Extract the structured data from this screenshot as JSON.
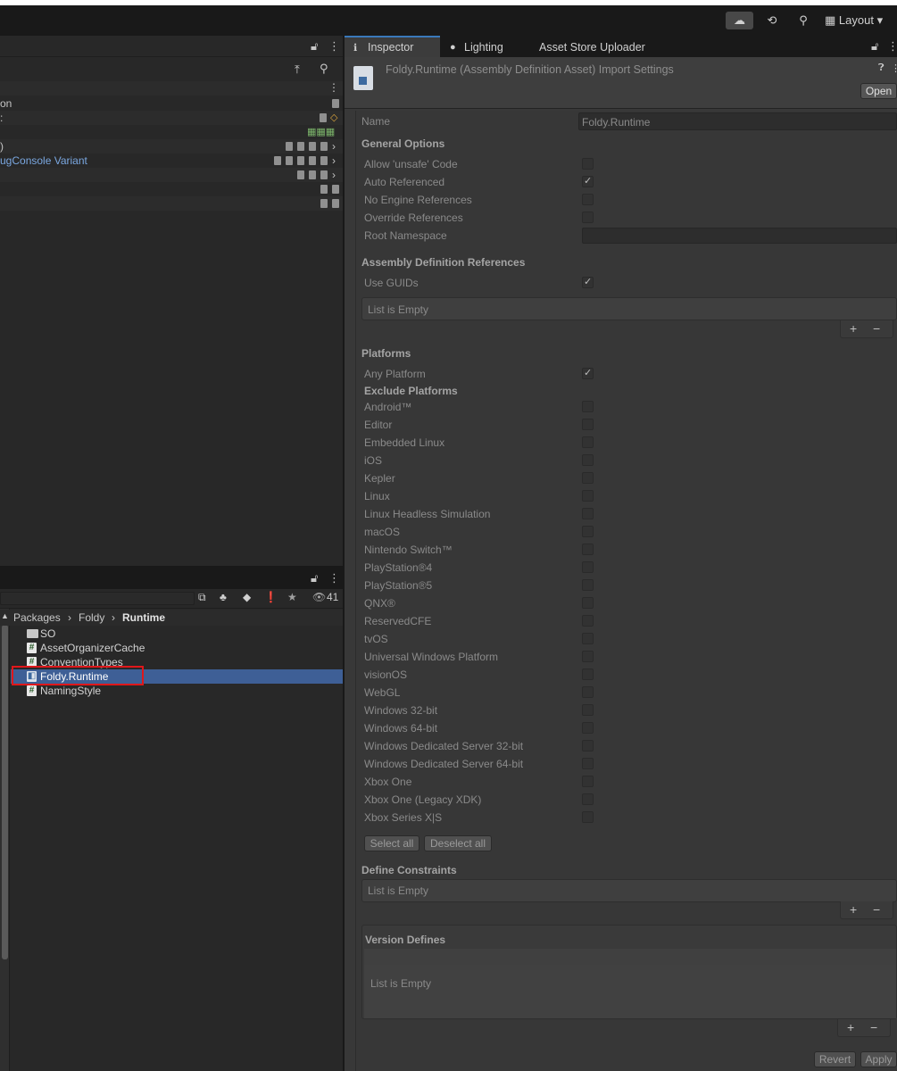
{
  "toolbar": {
    "layout_label": "Layout"
  },
  "hierarchy": {
    "rows": [
      "on",
      "",
      "",
      "",
      "ugConsole Variant",
      "",
      "",
      ""
    ]
  },
  "project": {
    "favorite_count": "41",
    "breadcrumb": [
      "Packages",
      "Foldy",
      "Runtime"
    ],
    "items": [
      {
        "name": "SO",
        "icon": "folder-icon"
      },
      {
        "name": "AssetOrganizerCache",
        "icon": "script-icon"
      },
      {
        "name": "ConventionTypes",
        "icon": "script-icon"
      },
      {
        "name": "Foldy.Runtime",
        "icon": "assembly-definition-icon"
      },
      {
        "name": "NamingStyle",
        "icon": "script-icon"
      }
    ]
  },
  "inspector": {
    "tabs": [
      "Inspector",
      "Lighting",
      "Asset Store Uploader"
    ],
    "title": "Foldy.Runtime (Assembly Definition Asset) Import Settings",
    "open_label": "Open",
    "name_label": "Name",
    "name_value": "Foldy.Runtime",
    "general_header": "General Options",
    "general": [
      {
        "label": "Allow 'unsafe' Code",
        "checked": false
      },
      {
        "label": "Auto Referenced",
        "checked": true
      },
      {
        "label": "No Engine References",
        "checked": false
      },
      {
        "label": "Override References",
        "checked": false
      }
    ],
    "root_namespace_label": "Root Namespace",
    "refs_header": "Assembly Definition References",
    "use_guids_label": "Use GUIDs",
    "list_empty": "List is Empty",
    "platforms_header": "Platforms",
    "any_platform_label": "Any Platform",
    "exclude_header": "Exclude Platforms",
    "platforms": [
      "Android™",
      "Editor",
      "Embedded Linux",
      "iOS",
      "Kepler",
      "Linux",
      "Linux Headless Simulation",
      "macOS",
      "Nintendo Switch™",
      "PlayStation®4",
      "PlayStation®5",
      "QNX®",
      "ReservedCFE",
      "tvOS",
      "Universal Windows Platform",
      "visionOS",
      "WebGL",
      "Windows 32-bit",
      "Windows 64-bit",
      "Windows Dedicated Server 32-bit",
      "Windows Dedicated Server 64-bit",
      "Xbox One",
      "Xbox One (Legacy XDK)",
      "Xbox Series X|S"
    ],
    "select_all": "Select all",
    "deselect_all": "Deselect all",
    "define_header": "Define Constraints",
    "version_header": "Version Defines",
    "plus": "+",
    "minus": "−",
    "revert": "Revert",
    "apply": "Apply"
  }
}
